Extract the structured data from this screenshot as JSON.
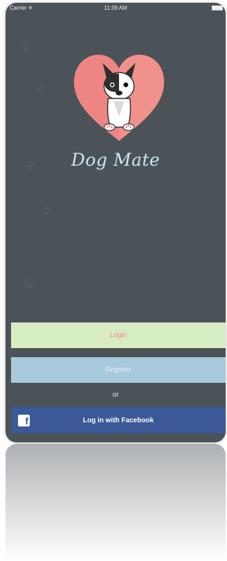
{
  "status_bar": {
    "carrier": "Carrier ✈",
    "time": "11:39 AM"
  },
  "app": {
    "name": "Dog Mate"
  },
  "buttons": {
    "login": "Login",
    "register": "Register",
    "or": "or",
    "facebook": "Log in with Facebook"
  },
  "icons": {
    "logo": "heart-dog-logo-icon",
    "facebook": "facebook-icon",
    "paw": "paw-print-icon"
  },
  "colors": {
    "background": "#4b5258",
    "login_bg": "#d8ecc4",
    "register_bg": "#a9c9dc",
    "facebook_bg": "#3b5998",
    "heart": "#ee8585"
  }
}
